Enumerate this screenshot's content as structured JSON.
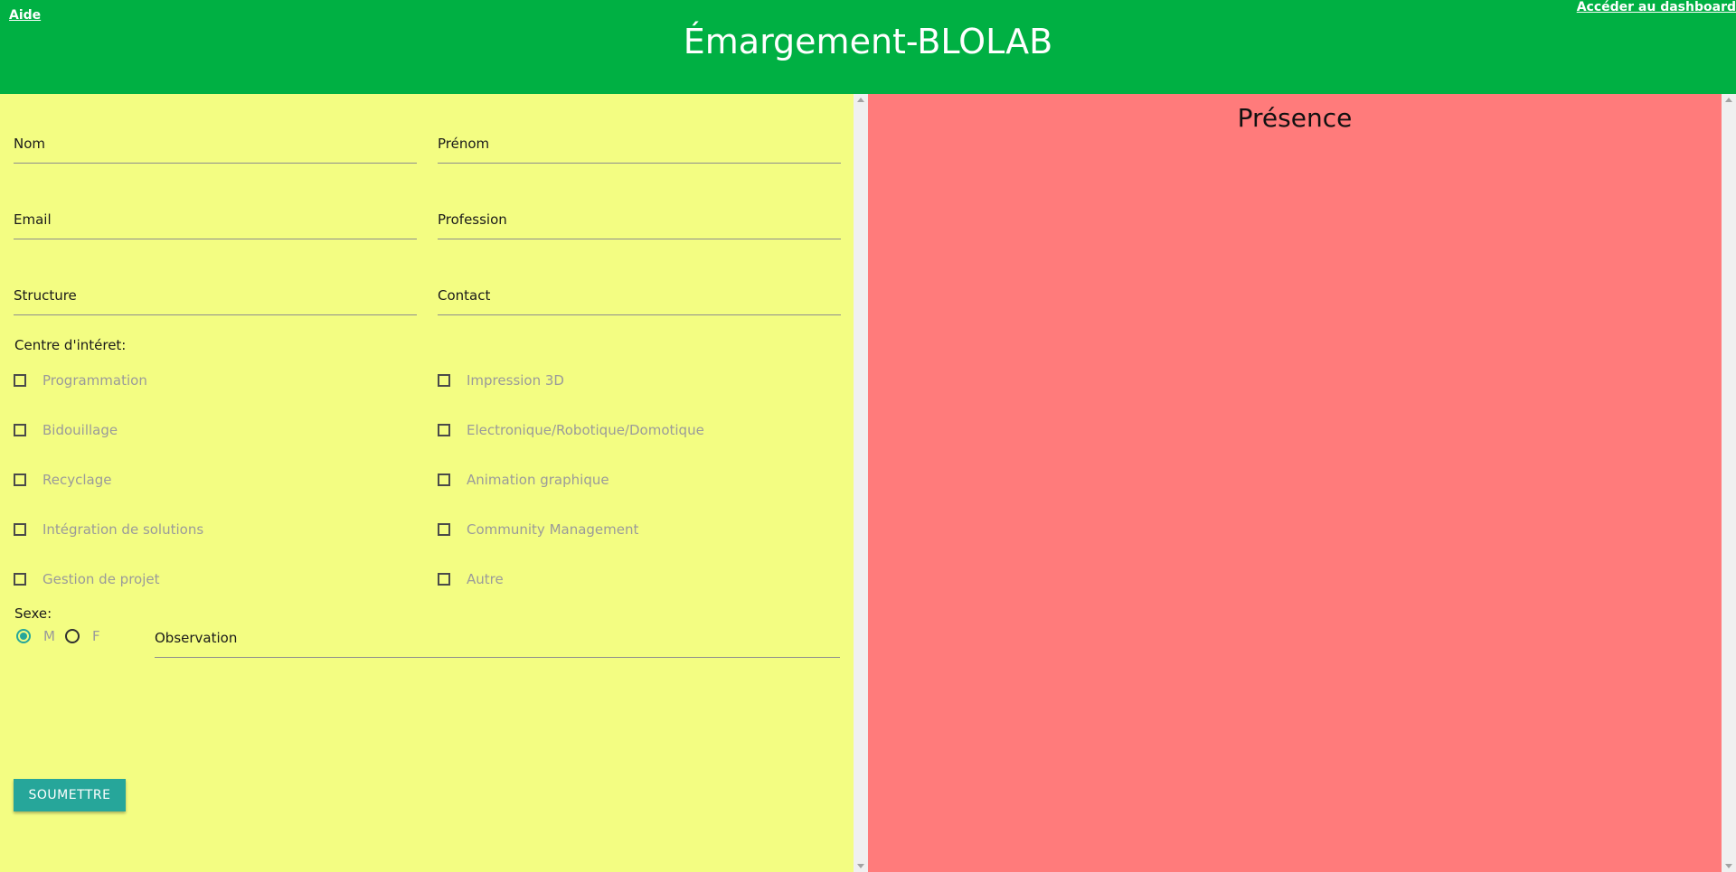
{
  "header": {
    "help_link": "Aide",
    "title": "Émargement-BLOLAB",
    "dashboard_link": "Accéder au dashboard"
  },
  "form": {
    "fields": {
      "nom": "Nom",
      "prenom": "Prénom",
      "email": "Email",
      "profession": "Profession",
      "structure": "Structure",
      "contact": "Contact",
      "observation": "Observation"
    },
    "interests_label": "Centre d'intéret:",
    "interests": [
      {
        "label": "Programmation",
        "checked": false
      },
      {
        "label": "Impression 3D",
        "checked": false
      },
      {
        "label": "Bidouillage",
        "checked": false
      },
      {
        "label": "Electronique/Robotique/Domotique",
        "checked": false
      },
      {
        "label": "Recyclage",
        "checked": false
      },
      {
        "label": "Animation graphique",
        "checked": false
      },
      {
        "label": "Intégration de solutions",
        "checked": false
      },
      {
        "label": "Community Management",
        "checked": false
      },
      {
        "label": "Gestion de projet",
        "checked": false
      },
      {
        "label": "Autre",
        "checked": false
      }
    ],
    "sex_label": "Sexe:",
    "sex_options": [
      {
        "label": "M",
        "checked": true
      },
      {
        "label": "F",
        "checked": false
      }
    ],
    "submit_label": "SOUMETTRE"
  },
  "presence": {
    "title": "Présence"
  },
  "colors": {
    "header": "#00b043",
    "form_bg": "#f3fd82",
    "presence_bg": "#ff7b7b",
    "accent": "#26a69a"
  }
}
